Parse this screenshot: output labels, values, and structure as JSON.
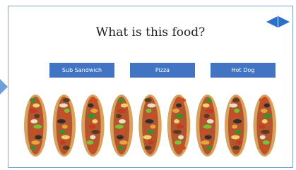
{
  "question": "What is this food?",
  "answers": [
    "Sub Sandwich",
    "Pizza",
    "Hot Dog"
  ],
  "image": {
    "count": 9,
    "subject": "hot dogs with toppings"
  },
  "colors": {
    "button": "#4274c4",
    "nav": "#2c6fcb",
    "border": "#7aa2d4"
  },
  "icons": {
    "nav_prev": "triangle-left-icon",
    "nav_next": "triangle-right-icon",
    "side_tab": "triangle-right-icon"
  }
}
